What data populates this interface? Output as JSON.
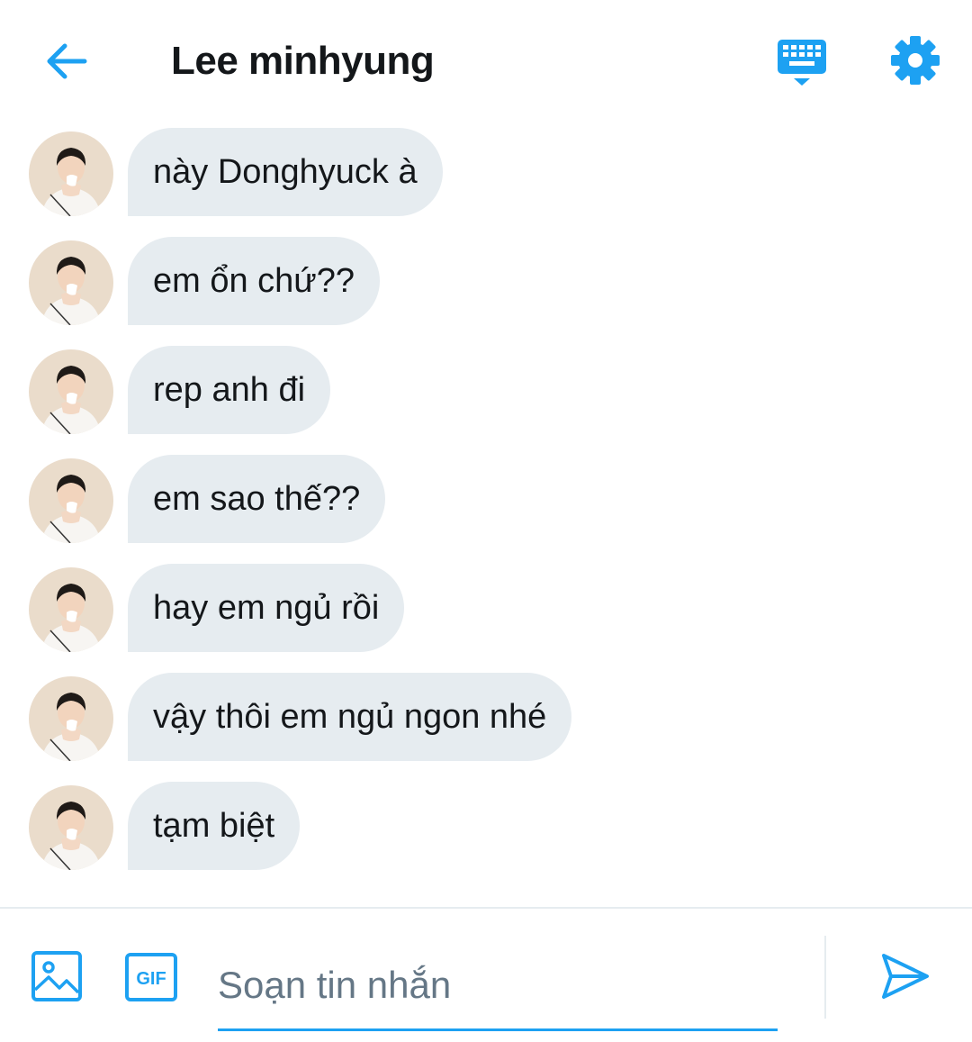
{
  "header": {
    "title": "Lee minhyung",
    "back_icon": "arrow-left-icon",
    "keyboard_icon": "keyboard-icon",
    "settings_icon": "gear-icon"
  },
  "messages": [
    {
      "text": "này Donghyuck à"
    },
    {
      "text": "em ổn chứ??"
    },
    {
      "text": "rep anh đi"
    },
    {
      "text": "em sao thế??"
    },
    {
      "text": "hay em ngủ rồi"
    },
    {
      "text": "vậy thôi em ngủ ngon nhé"
    },
    {
      "text": "tạm biệt"
    }
  ],
  "composer": {
    "placeholder": "Soạn tin nhắn",
    "value": "",
    "gif_label": "GIF",
    "image_icon": "image-icon",
    "send_icon": "send-icon"
  },
  "colors": {
    "accent": "#1da1f2",
    "bubble": "#e6ecf0",
    "text": "#14171a",
    "placeholder": "#657786"
  }
}
